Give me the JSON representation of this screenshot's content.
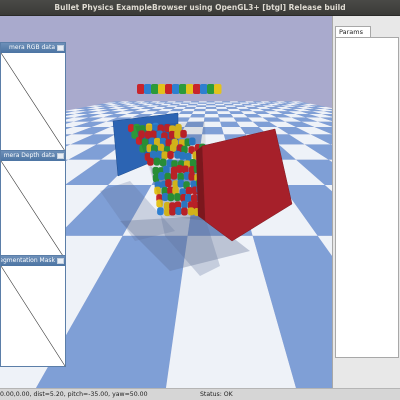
{
  "window": {
    "title": "Bullet Physics ExampleBrowser using OpenGL3+ [btgl] Release build"
  },
  "panels": [
    {
      "title": "Camera RGB data",
      "shown_label": "mera RGB data"
    },
    {
      "title": "Camera Depth data",
      "shown_label": "mera Depth data"
    },
    {
      "title": "Segmentation Mask",
      "shown_label": "Segmentation Mask"
    }
  ],
  "params": {
    "tab_label": "Params"
  },
  "status": {
    "camera": "0.00,0.00, dist=5.20, pitch=-35.00, yaw=50.00",
    "state": "Status: OK"
  },
  "scene": {
    "sky_color": "#a9aacd",
    "floor_light": "#eef2f8",
    "floor_dark": "#7f9fd6",
    "blue_wall": "#2c64b3",
    "red_wall": "#a6202a",
    "cylinder_colors": [
      "#c8242b",
      "#2e7fd0",
      "#2c9a3a",
      "#e3c21d"
    ]
  }
}
